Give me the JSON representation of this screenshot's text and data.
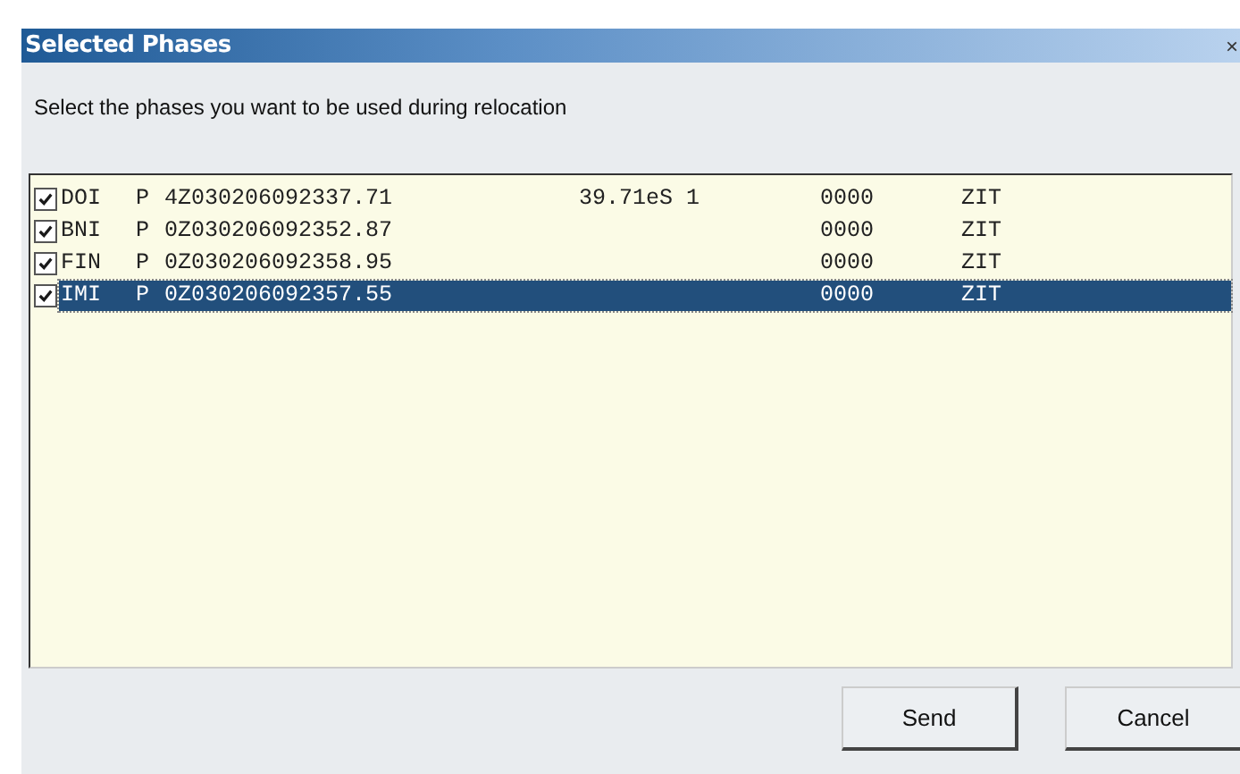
{
  "window": {
    "title": "Selected Phases",
    "close": "×"
  },
  "instruction": "Select the phases you want to be used during relocation",
  "rows": [
    {
      "checked": true,
      "selected": false,
      "name": "DOI",
      "phase": "P",
      "time": "4Z030206092337.71",
      "column_4": "39.71eS 1",
      "code": "0000",
      "column_6": "ZIT"
    },
    {
      "checked": true,
      "selected": false,
      "name": "BNI",
      "phase": "P",
      "time": "0Z030206092352.87",
      "code": "0000",
      "column_6": "ZIT"
    },
    {
      "checked": true,
      "selected": false,
      "name": "FIN",
      "phase": "P",
      "time": "0Z030206092358.95",
      "code": "0000",
      "column_6": "ZIT"
    },
    {
      "checked": true,
      "selected": true,
      "name": "IMI",
      "phase": "P",
      "time": "0Z030206092357.55",
      "code": "0000",
      "column_6": "ZIT"
    }
  ],
  "buttons": [
    "Send",
    "Cancel"
  ]
}
